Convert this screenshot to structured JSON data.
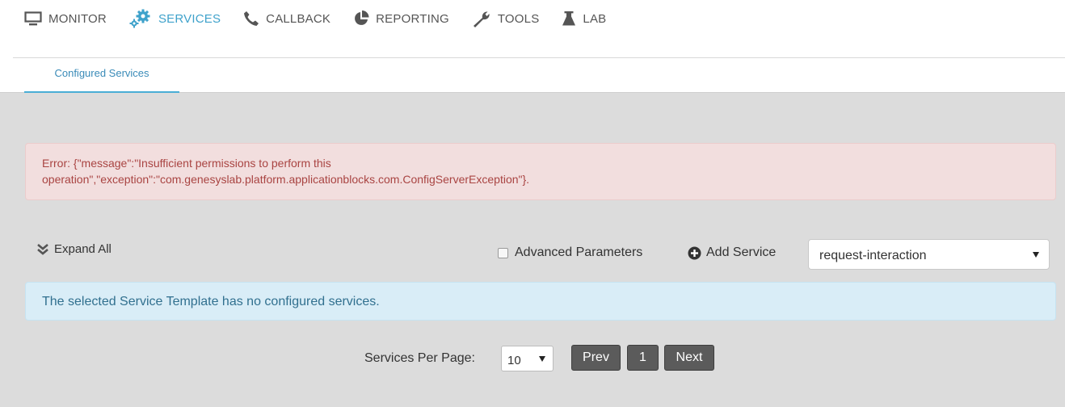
{
  "nav": {
    "items": [
      {
        "label": "MONITOR",
        "icon": "monitor-icon",
        "active": false
      },
      {
        "label": "SERVICES",
        "icon": "gears-icon",
        "active": true
      },
      {
        "label": "CALLBACK",
        "icon": "phone-icon",
        "active": false
      },
      {
        "label": "REPORTING",
        "icon": "pie-chart-icon",
        "active": false
      },
      {
        "label": "TOOLS",
        "icon": "wrench-icon",
        "active": false
      },
      {
        "label": "LAB",
        "icon": "flask-icon",
        "active": false
      }
    ]
  },
  "subtabs": {
    "active_label": "Configured Services"
  },
  "error_alert": {
    "line1": "Error: {\"message\":\"Insufficient permissions to perform this",
    "line2": "operation\",\"exception\":\"com.genesyslab.platform.applicationblocks.com.ConfigServerException\"}."
  },
  "toolbar": {
    "expand_all_label": "Expand All",
    "advanced_parameters_label": "Advanced Parameters",
    "advanced_parameters_checked": false,
    "add_service_label": "Add Service",
    "template_select_value": "request-interaction"
  },
  "info_alert": {
    "text": "The selected Service Template has no configured services."
  },
  "pager": {
    "per_page_label": "Services Per Page:",
    "per_page_value": "10",
    "prev_label": "Prev",
    "current_page": "1",
    "next_label": "Next"
  },
  "colors": {
    "accent": "#3fa2cb",
    "error_bg": "#f2dede",
    "error_text": "#a94442",
    "info_bg": "#d9edf7",
    "info_text": "#31708f",
    "panel_bg": "#dcdcdc",
    "button_bg": "#5b5b5b"
  }
}
